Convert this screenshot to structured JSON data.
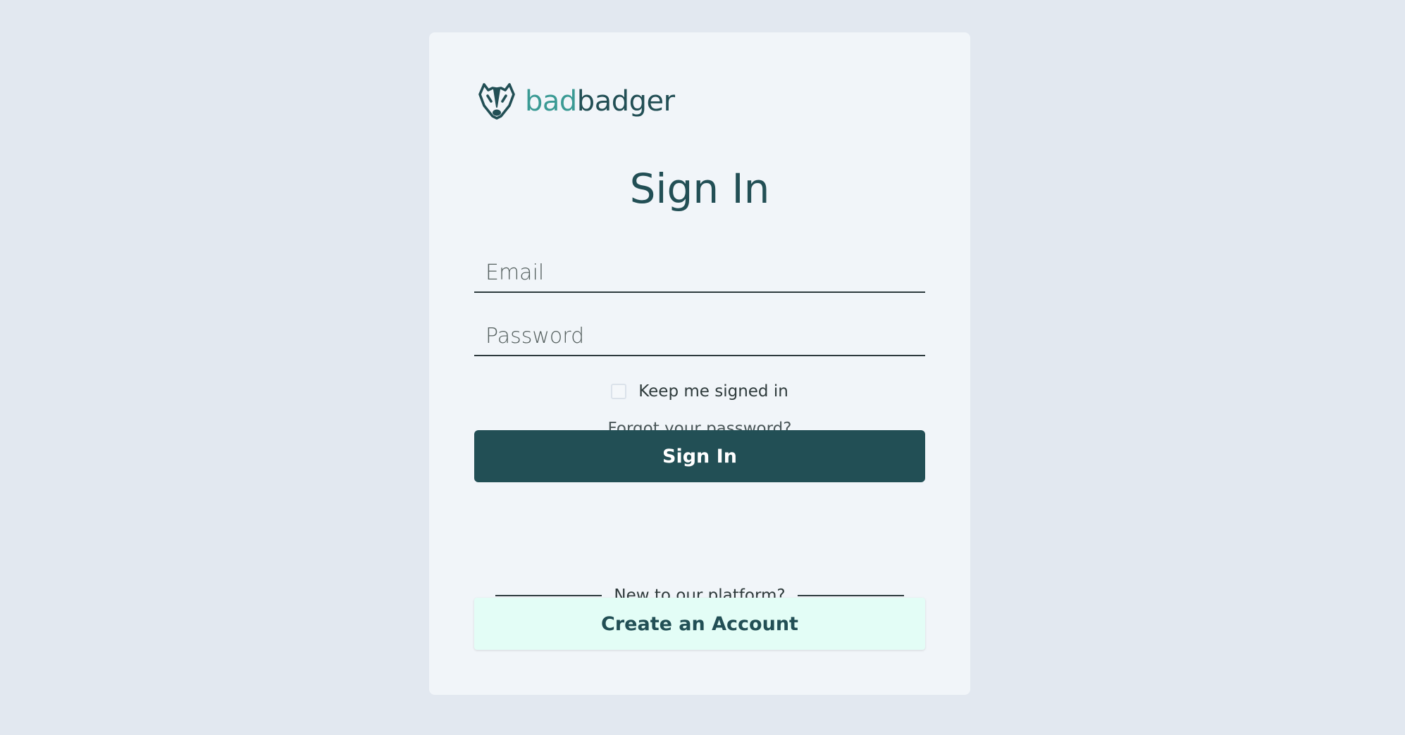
{
  "brand": {
    "icon": "badger-icon",
    "name_part1": "bad",
    "name_part2": "badger",
    "colors": {
      "accent": "#3a9a94",
      "primary": "#224f55"
    }
  },
  "form": {
    "title": "Sign In",
    "email": {
      "placeholder": "Email",
      "value": ""
    },
    "password": {
      "placeholder": "Password",
      "value": ""
    },
    "remember": {
      "label": "Keep me signed in",
      "checked": false
    },
    "forgot_link": "Forgot your password?",
    "submit_label": "Sign In"
  },
  "signup": {
    "divider_text": "New to our platform?",
    "button_label": "Create an Account",
    "button_bg": "#e3fdf6"
  },
  "page": {
    "background": "#e2e8f0",
    "card_background": "#f1f5f9"
  }
}
